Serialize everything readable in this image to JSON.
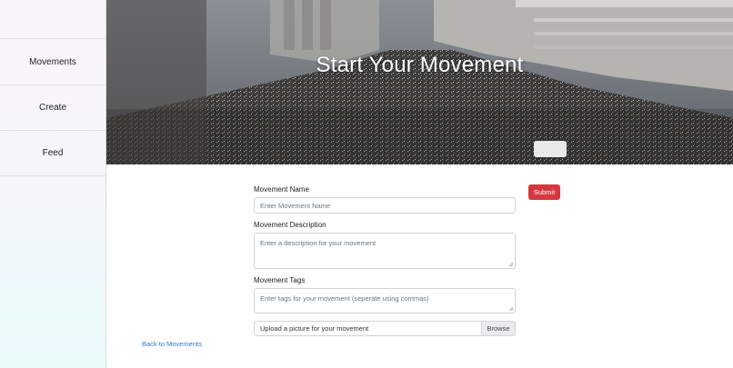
{
  "sidebar": {
    "items": [
      {
        "label": ""
      },
      {
        "label": "Movements"
      },
      {
        "label": "Create"
      },
      {
        "label": "Feed"
      }
    ]
  },
  "hero": {
    "title": "Start Your Movement"
  },
  "form": {
    "name_label": "Movement Name",
    "name_placeholder": "Enter Movement Name",
    "description_label": "Movement Description",
    "description_placeholder": "Enter a description for your movement",
    "tags_label": "Movement Tags",
    "tags_placeholder": "Enter tags for your movement (seperate using commas)",
    "file_label": "Upload a picture for your movement",
    "browse_label": "Browse",
    "submit_label": "Submit"
  },
  "back_link": "Back to Movements",
  "colors": {
    "submit": "#d3383f",
    "link": "#2f79d6"
  }
}
